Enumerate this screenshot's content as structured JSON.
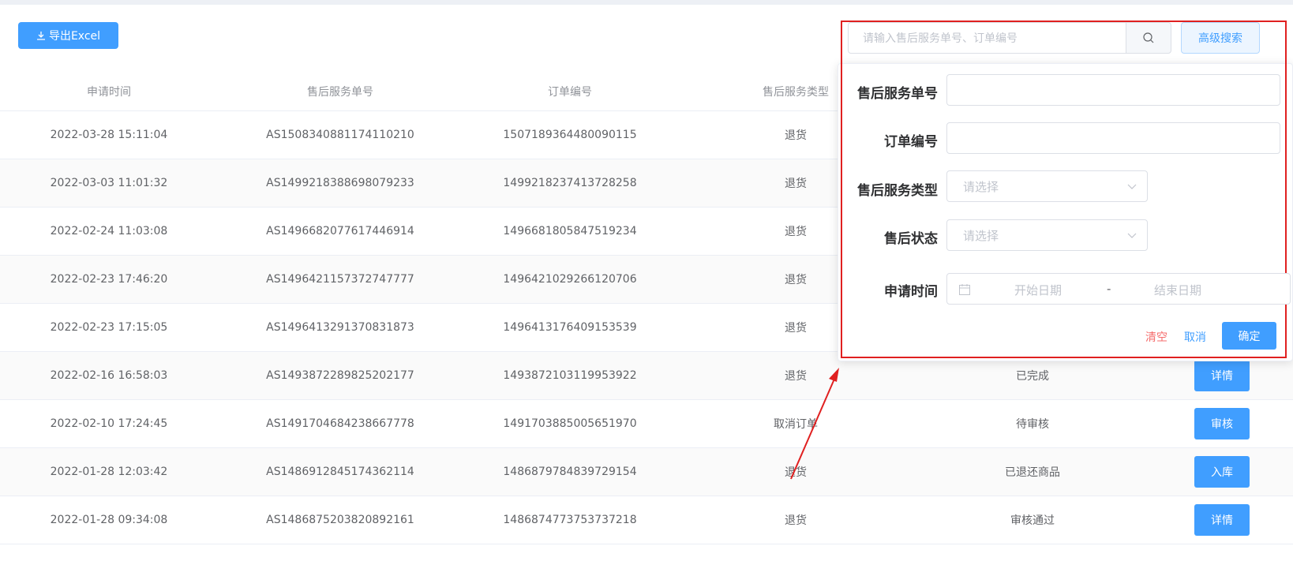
{
  "toolbar": {
    "export_label": "导出Excel"
  },
  "table": {
    "headers": [
      "申请时间",
      "售后服务单号",
      "订单编号",
      "售后服务类型"
    ],
    "rows": [
      {
        "time": "2022-03-28 15:11:04",
        "service_no": "AS1508340881174110210",
        "order_no": "1507189364480090115",
        "type": "退货",
        "status": "",
        "action": ""
      },
      {
        "time": "2022-03-03 11:01:32",
        "service_no": "AS1499218388698079233",
        "order_no": "1499218237413728258",
        "type": "退货",
        "status": "",
        "action": ""
      },
      {
        "time": "2022-02-24 11:03:08",
        "service_no": "AS1496682077617446914",
        "order_no": "1496681805847519234",
        "type": "退货",
        "status": "",
        "action": ""
      },
      {
        "time": "2022-02-23 17:46:20",
        "service_no": "AS1496421157372747777",
        "order_no": "1496421029266120706",
        "type": "退货",
        "status": "",
        "action": ""
      },
      {
        "time": "2022-02-23 17:15:05",
        "service_no": "AS1496413291370831873",
        "order_no": "1496413176409153539",
        "type": "退货",
        "status": "",
        "action": ""
      },
      {
        "time": "2022-02-16 16:58:03",
        "service_no": "AS1493872289825202177",
        "order_no": "1493872103119953922",
        "type": "退货",
        "status": "已完成",
        "action": "详情"
      },
      {
        "time": "2022-02-10 17:24:45",
        "service_no": "AS1491704684238667778",
        "order_no": "1491703885005651970",
        "type": "取消订单",
        "status": "待审核",
        "action": "审核"
      },
      {
        "time": "2022-01-28 12:03:42",
        "service_no": "AS1486912845174362114",
        "order_no": "1486879784839729154",
        "type": "退货",
        "status": "已退还商品",
        "action": "入库"
      },
      {
        "time": "2022-01-28 09:34:08",
        "service_no": "AS1486875203820892161",
        "order_no": "1486874773753737218",
        "type": "退货",
        "status": "审核通过",
        "action": "详情"
      }
    ]
  },
  "search": {
    "placeholder": "请输入售后服务单号、订单编号",
    "advanced_label": "高级搜索"
  },
  "advanced": {
    "service_no_label": "售后服务单号",
    "order_no_label": "订单编号",
    "service_type_label": "售后服务类型",
    "service_type_placeholder": "请选择",
    "status_label": "售后状态",
    "status_placeholder": "请选择",
    "apply_time_label": "申请时间",
    "start_placeholder": "开始日期",
    "end_placeholder": "结束日期",
    "date_separator": "-",
    "clear_label": "清空",
    "cancel_label": "取消",
    "confirm_label": "确定"
  },
  "colors": {
    "primary": "#409eff",
    "danger": "#f56c6c",
    "annotation": "#e02020"
  }
}
